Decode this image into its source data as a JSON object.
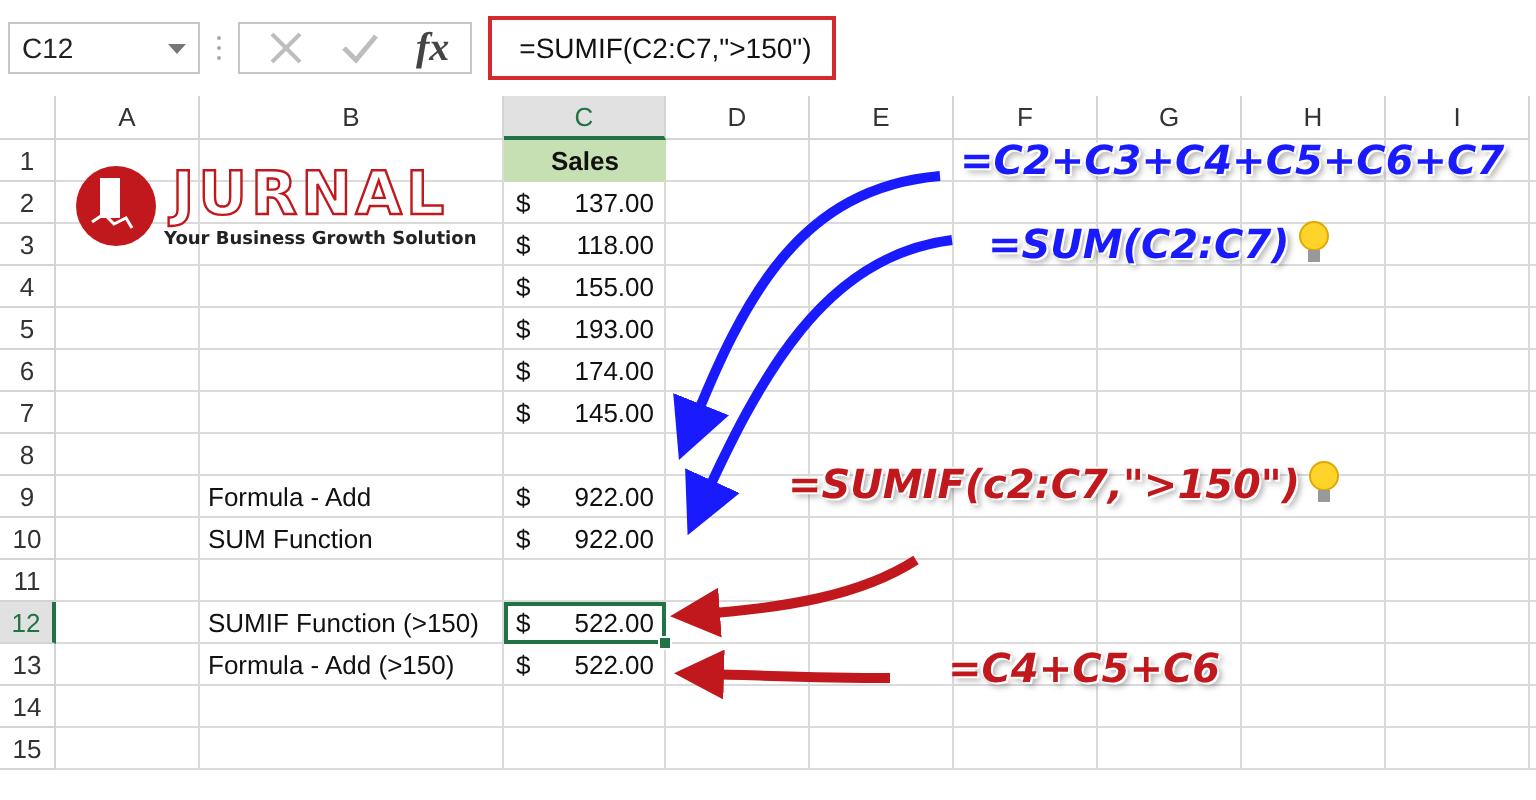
{
  "name_box": {
    "value": "C12"
  },
  "formula_bar": {
    "function_label": "fx",
    "value": "=SUMIF(C2:C7,\">150\")",
    "highlighted": true
  },
  "columns": [
    {
      "label": "A",
      "selected": false
    },
    {
      "label": "B",
      "selected": false
    },
    {
      "label": "C",
      "selected": true
    },
    {
      "label": "D",
      "selected": false
    },
    {
      "label": "E",
      "selected": false
    },
    {
      "label": "F",
      "selected": false
    },
    {
      "label": "G",
      "selected": false
    },
    {
      "label": "H",
      "selected": false
    },
    {
      "label": "I",
      "selected": false
    }
  ],
  "rows": [
    {
      "number": "1",
      "selected": false,
      "value": {
        "kind": "header",
        "text": "Sales",
        "selected": false
      }
    },
    {
      "number": "2",
      "selected": false,
      "value": {
        "kind": "accounting",
        "currency": "$",
        "text": "137.00",
        "selected": false
      }
    },
    {
      "number": "3",
      "selected": false,
      "value": {
        "kind": "accounting",
        "currency": "$",
        "text": "118.00",
        "selected": false
      }
    },
    {
      "number": "4",
      "selected": false,
      "value": {
        "kind": "accounting",
        "currency": "$",
        "text": "155.00",
        "selected": false
      }
    },
    {
      "number": "5",
      "selected": false,
      "value": {
        "kind": "accounting",
        "currency": "$",
        "text": "193.00",
        "selected": false
      }
    },
    {
      "number": "6",
      "selected": false,
      "value": {
        "kind": "accounting",
        "currency": "$",
        "text": "174.00",
        "selected": false
      }
    },
    {
      "number": "7",
      "selected": false,
      "value": {
        "kind": "accounting",
        "currency": "$",
        "text": "145.00",
        "selected": false
      }
    },
    {
      "number": "8",
      "selected": false
    },
    {
      "number": "9",
      "selected": false,
      "label": {
        "text": "Formula - Add",
        "selected": false
      },
      "value": {
        "kind": "accounting",
        "currency": "$",
        "text": "922.00",
        "selected": false
      }
    },
    {
      "number": "10",
      "selected": false,
      "label": {
        "text": "SUM Function",
        "selected": false
      },
      "value": {
        "kind": "accounting",
        "currency": "$",
        "text": "922.00",
        "selected": false
      }
    },
    {
      "number": "11",
      "selected": false
    },
    {
      "number": "12",
      "selected": true,
      "label": {
        "text": "SUMIF Function (>150)",
        "selected": false
      },
      "value": {
        "kind": "accounting",
        "currency": "$",
        "text": "522.00",
        "selected": true
      }
    },
    {
      "number": "13",
      "selected": false,
      "label": {
        "text": "Formula - Add (>150)",
        "selected": false
      },
      "value": {
        "kind": "accounting",
        "currency": "$",
        "text": "522.00",
        "selected": false
      }
    },
    {
      "number": "14",
      "selected": false
    },
    {
      "number": "15",
      "selected": false
    }
  ],
  "logo": {
    "name": "JURNAL",
    "tagline": "Your Business Growth Solution"
  },
  "annotations": [
    {
      "text": "=C2+C3+C4+C5+C6+C7",
      "color": "#1a1aff",
      "bulb": false
    },
    {
      "text": "=SUM(C2:C7)",
      "color": "#1a1aff",
      "bulb": true
    },
    {
      "text": "=SUMIF(c2:C7,\">150\")",
      "color": "#c0181c",
      "bulb": true
    },
    {
      "text": "=C4+C5+C6",
      "color": "#c0181c",
      "bulb": false
    }
  ]
}
